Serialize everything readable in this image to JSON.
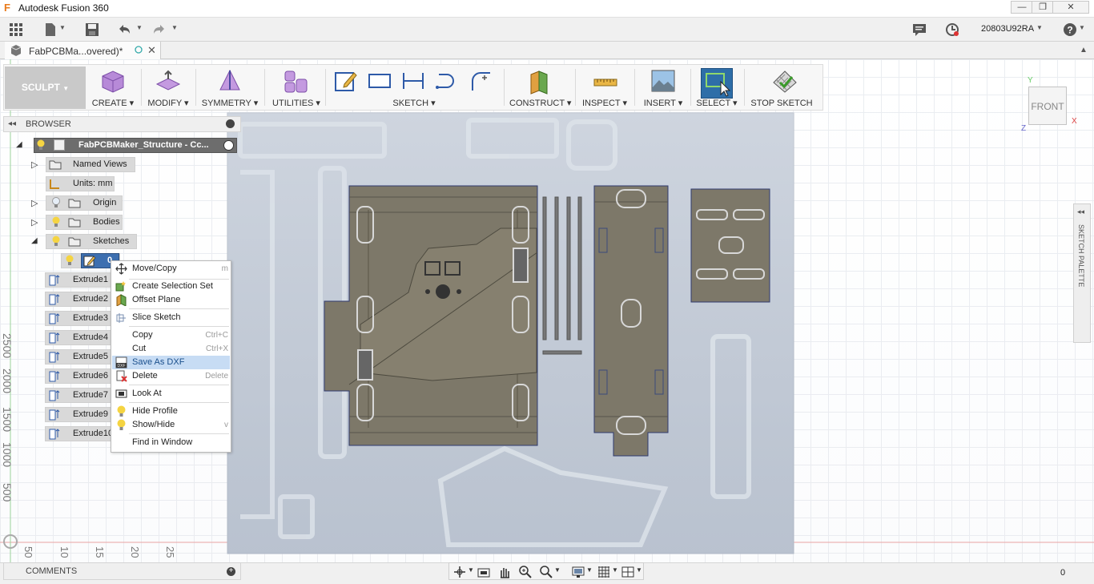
{
  "app": {
    "title": "Autodesk Fusion 360",
    "logo": "F"
  },
  "window": {
    "minimize": "—",
    "maximize": "❐",
    "close": "✕"
  },
  "qat": {
    "user": "20803U92RA",
    "help": "?"
  },
  "tab": {
    "name": "FabPCBMa...overed)*"
  },
  "toolbar": {
    "workspace": "SCULPT",
    "groups": [
      {
        "label": "CREATE"
      },
      {
        "label": "MODIFY"
      },
      {
        "label": "SYMMETRY"
      },
      {
        "label": "UTILITIES"
      },
      {
        "label": "SKETCH"
      },
      {
        "label": "CONSTRUCT"
      },
      {
        "label": "INSPECT"
      },
      {
        "label": "INSERT"
      },
      {
        "label": "SELECT"
      },
      {
        "label": "STOP SKETCH"
      }
    ]
  },
  "browser": {
    "title": "BROWSER",
    "root": "FabPCBMaker_Structure - Cc...",
    "named_views": "Named Views",
    "units": "Units: mm",
    "origin": "Origin",
    "bodies": "Bodies",
    "sketches": "Sketches",
    "sketch_item": "0",
    "extrudes": [
      "Extrude1",
      "Extrude2",
      "Extrude3",
      "Extrude4",
      "Extrude5",
      "Extrude6",
      "Extrude7",
      "Extrude9",
      "Extrude10"
    ]
  },
  "context_menu": {
    "items": [
      {
        "label": "Move/Copy",
        "shortcut": "m"
      },
      {
        "label": "Create Selection Set",
        "shortcut": ""
      },
      {
        "label": "Offset Plane",
        "shortcut": ""
      },
      {
        "label": "Slice Sketch",
        "shortcut": ""
      },
      {
        "label": "Copy",
        "shortcut": "Ctrl+C"
      },
      {
        "label": "Cut",
        "shortcut": "Ctrl+X"
      },
      {
        "label": "Save As DXF",
        "shortcut": ""
      },
      {
        "label": "Delete",
        "shortcut": "Delete"
      },
      {
        "label": "Look At",
        "shortcut": ""
      },
      {
        "label": "Hide Profile",
        "shortcut": ""
      },
      {
        "label": "Show/Hide",
        "shortcut": "v"
      },
      {
        "label": "Find in Window",
        "shortcut": ""
      }
    ]
  },
  "ruler": {
    "vertical": [
      "2500",
      "2000",
      "1500",
      "1000",
      "500"
    ],
    "horizontal": [
      "50",
      "10",
      "15",
      "20",
      "25"
    ]
  },
  "viewcube": {
    "face": "FRONT",
    "x": "X",
    "y": "Y",
    "z": "Z"
  },
  "palette": {
    "label": "SKETCH PALETTE"
  },
  "comments": {
    "label": "COMMENTS"
  },
  "status": {
    "right_value": "0"
  }
}
